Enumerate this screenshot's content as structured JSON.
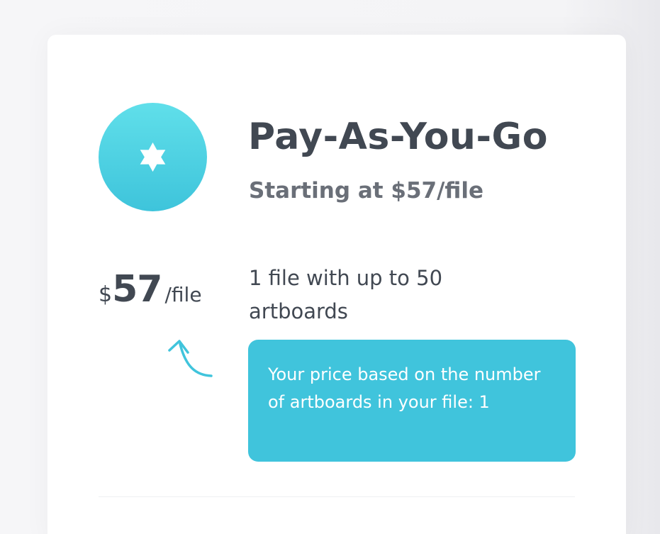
{
  "plan": {
    "icon": "star-icon",
    "title": "Pay-As-You-Go",
    "subtitle": "Starting at $57/file",
    "price": {
      "currency": "$",
      "amount": "57",
      "unit": "/file"
    },
    "feature": "1 file with up to 50 artboards",
    "tooltip": "Your price based on the number of artboards in your file: 1"
  },
  "colors": {
    "accent": "#40c4dc",
    "badge_top": "#60dfea",
    "badge_bottom": "#3ec4db",
    "text_dark": "#414852",
    "text_muted": "#6a6f78",
    "card_bg": "#ffffff"
  }
}
